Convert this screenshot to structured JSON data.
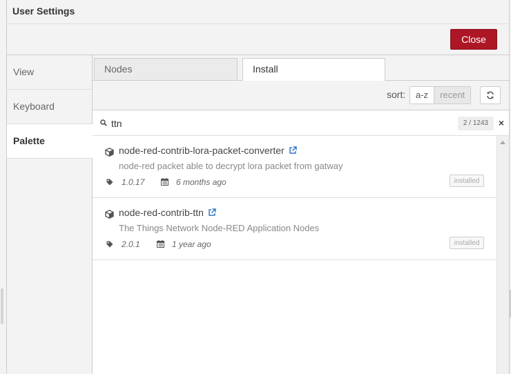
{
  "dialog": {
    "title": "User Settings",
    "close_label": "Close"
  },
  "sidebar": {
    "items": [
      {
        "label": "View"
      },
      {
        "label": "Keyboard"
      },
      {
        "label": "Palette"
      }
    ],
    "active": "Palette"
  },
  "tabs": [
    {
      "label": "Nodes"
    },
    {
      "label": "Install"
    }
  ],
  "toolbar": {
    "sort_label": "sort:",
    "sort_options": [
      "a-z",
      "recent"
    ],
    "sort_selected": "a-z"
  },
  "search": {
    "value": "ttn",
    "count": "2 / 1243",
    "clear_symbol": "×"
  },
  "results": [
    {
      "name": "node-red-contrib-lora-packet-converter",
      "description": "node-red packet able to decrypt lora packet from gatway",
      "version": "1.0.17",
      "updated": "6 months ago",
      "status": "installed"
    },
    {
      "name": "node-red-contrib-ttn",
      "description": "The Things Network Node-RED Application Nodes",
      "version": "2.0.1",
      "updated": "1 year ago",
      "status": "installed"
    }
  ],
  "colors": {
    "accent_close": "#ad1625",
    "link_icon": "#2b76c4"
  },
  "icons": {
    "package": "cube-icon",
    "external": "external-link-icon",
    "version": "tag-icon",
    "date": "calendar-icon",
    "search": "search-icon",
    "refresh": "refresh-icon"
  }
}
